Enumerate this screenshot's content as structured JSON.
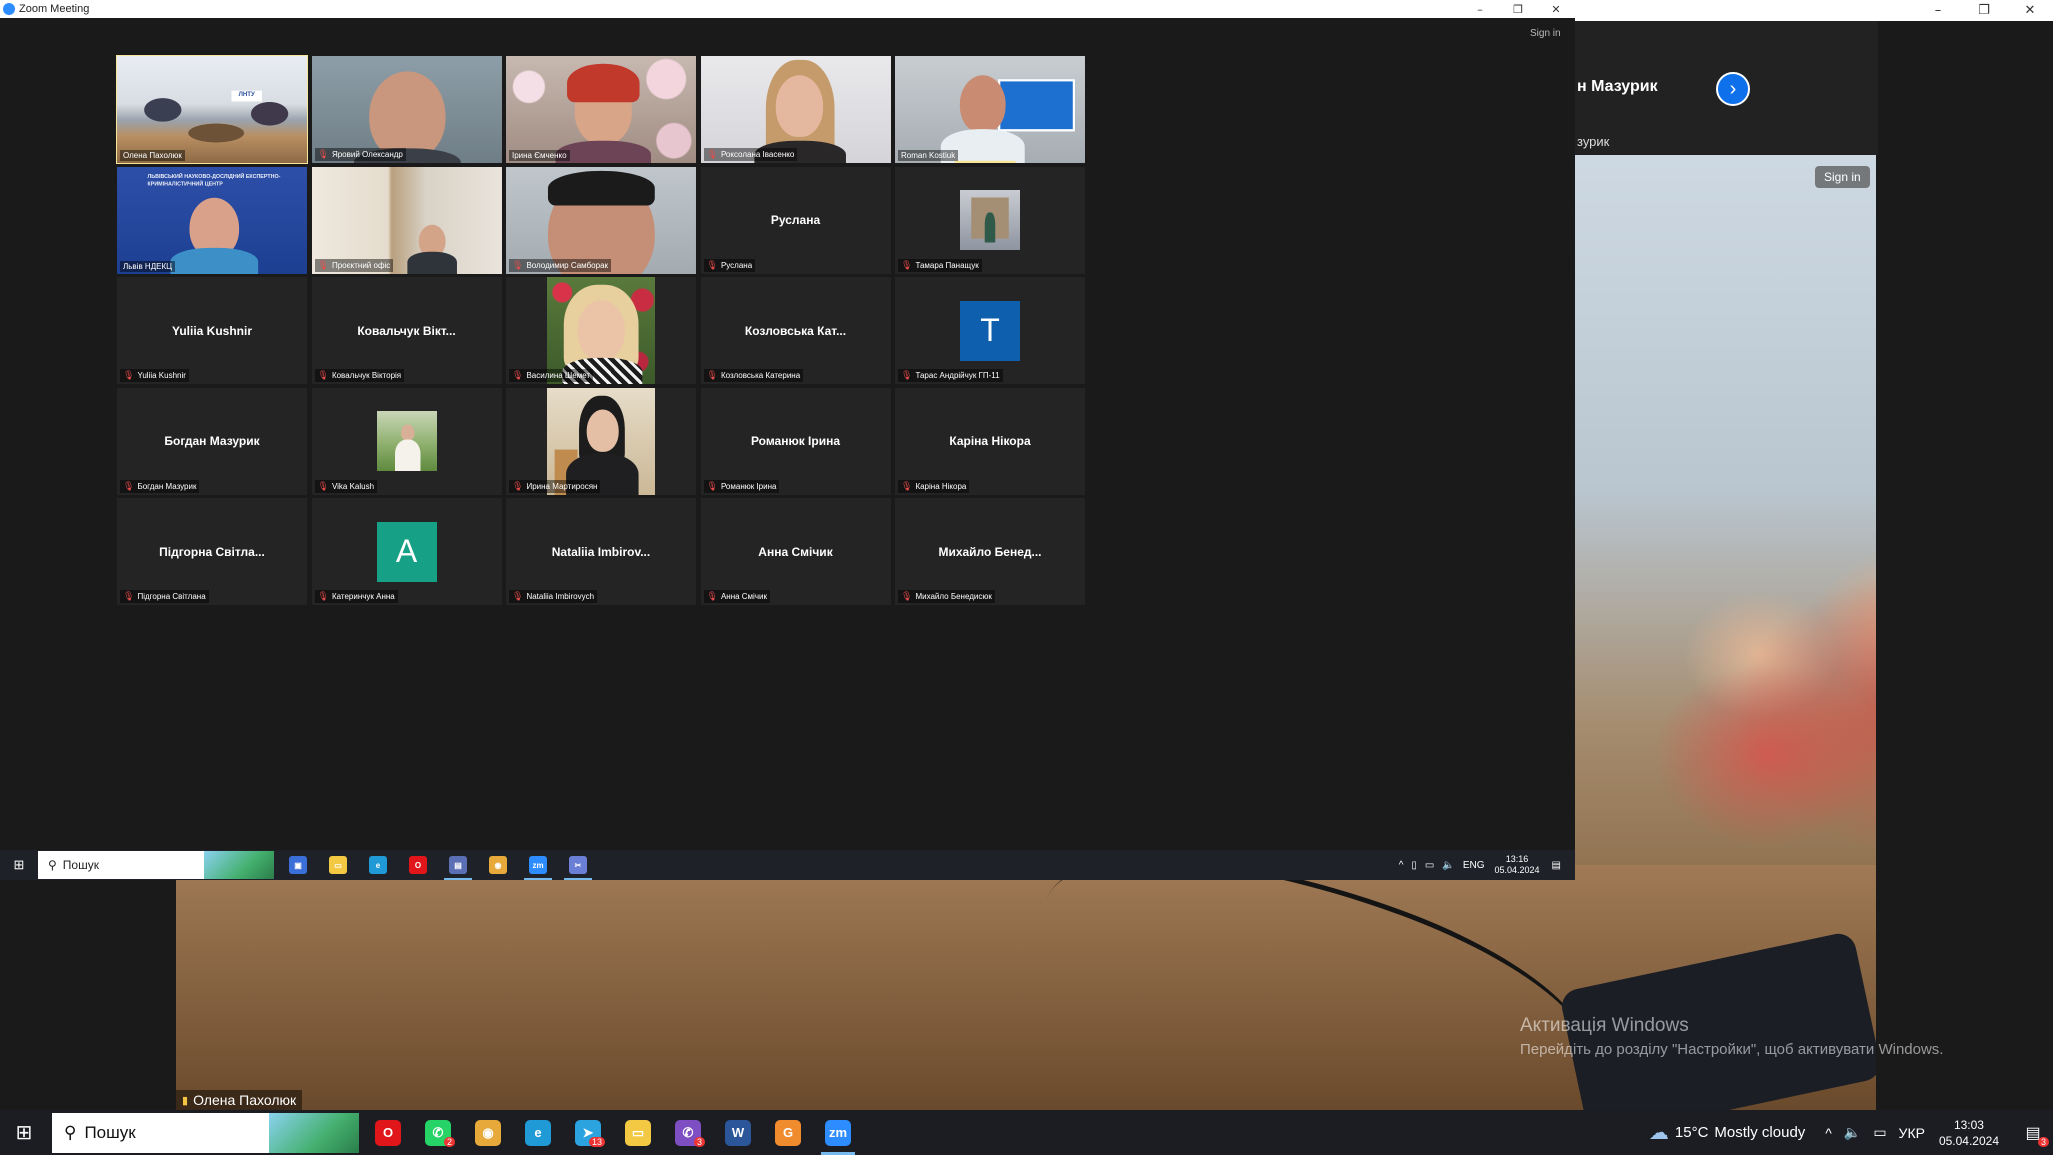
{
  "outer": {
    "speaker_name_partial": "н Мазурик",
    "speaker_sub_partial": "зурик",
    "sign_in": "Sign in",
    "active_speaker_label": "Олена Пахолюк",
    "window_controls": [
      "–",
      "❐",
      "✕"
    ]
  },
  "watermark": {
    "title": "Активація Windows",
    "text": "Перейдіть до розділу \"Настройки\", щоб активувати Windows."
  },
  "taskbar": {
    "search_placeholder": "Пошук",
    "apps": [
      {
        "name": "opera",
        "color": "#e0161b",
        "glyph": "O"
      },
      {
        "name": "whatsapp",
        "color": "#25d366",
        "glyph": "✆",
        "badge": "2"
      },
      {
        "name": "chrome",
        "color": "#e7a93a",
        "glyph": "◉"
      },
      {
        "name": "edge",
        "color": "#1f9ad6",
        "glyph": "e"
      },
      {
        "name": "telegram",
        "color": "#2aa3df",
        "glyph": "➤",
        "badge": "13"
      },
      {
        "name": "file-explorer",
        "color": "#f3c843",
        "glyph": "▭"
      },
      {
        "name": "viber",
        "color": "#7d4fc2",
        "glyph": "✆",
        "badge": "3"
      },
      {
        "name": "word",
        "color": "#2b579a",
        "glyph": "W"
      },
      {
        "name": "app",
        "color": "#f08b2e",
        "glyph": "G"
      },
      {
        "name": "zoom",
        "color": "#2d8cff",
        "glyph": "zm",
        "active": true
      }
    ],
    "weather_temp": "15°C",
    "weather_text": "Mostly cloudy",
    "language": "УКР",
    "time": "13:03",
    "date": "05.04.2024",
    "notifications": "3"
  },
  "zoom": {
    "title": "Zoom Meeting",
    "sign_in": "Sign in",
    "participants": [
      {
        "label": "Олена Пахолюк",
        "type": "video",
        "muted": false,
        "active": true,
        "scene": "room"
      },
      {
        "label": "Яровий Олександр",
        "type": "video",
        "muted": true,
        "scene": "man1"
      },
      {
        "label": "Ірина Ємченко",
        "type": "video",
        "muted": false,
        "scene": "woman-red"
      },
      {
        "label": "Роксолана Івасенко",
        "type": "video",
        "muted": true,
        "scene": "girl"
      },
      {
        "label": "Roman Kostiuk",
        "type": "video",
        "muted": false,
        "scene": "man-screen"
      },
      {
        "label": "Львів НДЕКЦ",
        "type": "video",
        "muted": false,
        "scene": "man-blue"
      },
      {
        "label": "Проєктний офіс",
        "type": "video",
        "muted": true,
        "scene": "man-small"
      },
      {
        "label": "Володимир Самборак",
        "type": "video",
        "muted": true,
        "scene": "man-close"
      },
      {
        "label": "Руслана",
        "type": "name",
        "display": "Руслана",
        "muted": true
      },
      {
        "label": "Тамара Панащук",
        "type": "photo",
        "muted": true,
        "scene": "photo-building"
      },
      {
        "label": "Yuliia Kushnir",
        "type": "name",
        "display": "Yuliia Kushnir",
        "muted": true
      },
      {
        "label": "Ковальчук Вікторія",
        "type": "name",
        "display": "Ковальчук Вікт...",
        "muted": true
      },
      {
        "label": "Василина Шемет",
        "type": "midphoto",
        "muted": true,
        "scene": "woman-blonde"
      },
      {
        "label": "Козловська Катерина",
        "type": "name",
        "display": "Козловська Кат...",
        "muted": true
      },
      {
        "label": "Тарас Андрійчук ГП-11",
        "type": "avatar",
        "letter": "T",
        "color": "#0e5fad",
        "muted": true
      },
      {
        "label": "Богдан Мазурик",
        "type": "name",
        "display": "Богдан Мазурик",
        "muted": true
      },
      {
        "label": "Vika Kalush",
        "type": "photo",
        "muted": true,
        "scene": "photo-field"
      },
      {
        "label": "Ирина Мартиросян",
        "type": "midphoto",
        "muted": true,
        "scene": "woman-dark"
      },
      {
        "label": "Романюк Ірина",
        "type": "name",
        "display": "Романюк Ірина",
        "muted": true
      },
      {
        "label": "Каріна Нікора",
        "type": "name",
        "display": "Каріна Нікора",
        "muted": true
      },
      {
        "label": "Підгорна Світлана",
        "type": "name",
        "display": "Підгорна Світла...",
        "muted": true
      },
      {
        "label": "Катеринчук Анна",
        "type": "avatar",
        "letter": "A",
        "color": "#16a085",
        "muted": true
      },
      {
        "label": "Nataliia Imbirovych",
        "type": "name",
        "display": "Nataliia Imbirov...",
        "muted": true
      },
      {
        "label": "Анна Смічик",
        "type": "name",
        "display": "Анна Смічик",
        "muted": true
      },
      {
        "label": "Михайло Бенедисюк",
        "type": "name",
        "display": "Михайло Бенед...",
        "muted": true
      }
    ]
  },
  "inner_taskbar": {
    "search_placeholder": "Пошук",
    "apps": [
      {
        "name": "save",
        "color": "#3a6fd8",
        "glyph": "▣"
      },
      {
        "name": "file-explorer",
        "color": "#f3c843",
        "glyph": "▭"
      },
      {
        "name": "edge",
        "color": "#1f9ad6",
        "glyph": "e"
      },
      {
        "name": "opera",
        "color": "#e0161b",
        "glyph": "O"
      },
      {
        "name": "app",
        "color": "#5b6fb5",
        "glyph": "▤",
        "active": true
      },
      {
        "name": "chrome",
        "color": "#e7a93a",
        "glyph": "◉"
      },
      {
        "name": "zoom",
        "color": "#2d8cff",
        "glyph": "zm",
        "active": true
      },
      {
        "name": "snipping",
        "color": "#6b7fd6",
        "glyph": "✂",
        "active": true
      }
    ],
    "language": "ENG",
    "time": "13:16",
    "date": "05.04.2024"
  }
}
